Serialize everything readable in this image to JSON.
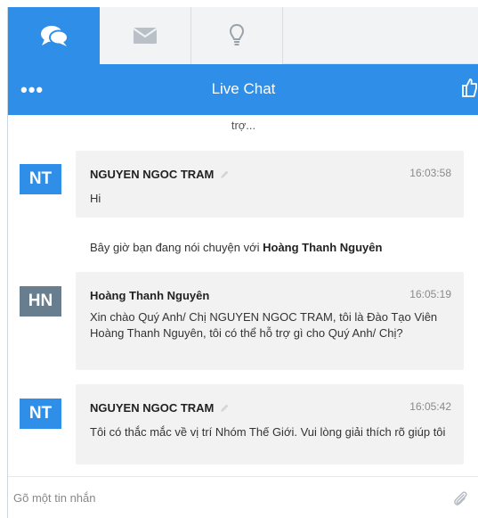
{
  "header": {
    "title": "Live Chat",
    "menu": "•••"
  },
  "tabs": [
    {
      "icon": "chat-bubbles-icon",
      "active": true
    },
    {
      "icon": "envelope-icon",
      "active": false
    },
    {
      "icon": "lightbulb-icon",
      "active": false
    }
  ],
  "messages": {
    "truncated": "trợ...",
    "items": [
      {
        "initials": "NT",
        "name": "NGUYEN NGOC TRAM",
        "time": "16:03:58",
        "text": "Hi"
      },
      {
        "initials": "HN",
        "name": "Hoàng Thanh Nguyên",
        "time": "16:05:19",
        "text": "Xin chào Quý Anh/ Chị NGUYEN NGOC TRAM, tôi là Đào Tạo Viên Hoàng Thanh Nguyên, tôi có thể hỗ trợ gì cho Quý Anh/ Chị?"
      },
      {
        "initials": "NT",
        "name": "NGUYEN NGOC TRAM",
        "time": "16:05:42",
        "text": "Tôi có thắc mắc về vị trí Nhóm Thế Giới. Vui lòng giải thích rõ giúp tôi"
      }
    ],
    "notice_prefix": "Bây giờ bạn đang nói chuyện với ",
    "notice_name": "Hoàng Thanh Nguyên"
  },
  "input": {
    "placeholder": "Gõ một tin nhắn"
  },
  "colors": {
    "accent": "#2f8fe8",
    "agent_avatar": "#687e8f",
    "bubble": "#f2f2f2"
  }
}
